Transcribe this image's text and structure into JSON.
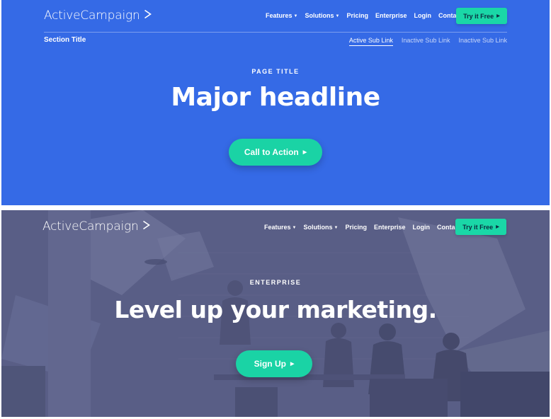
{
  "colors": {
    "blue_bg": "#356ae6",
    "accent_green": "#1ad3a5",
    "photo_overlay": "#5a5f84"
  },
  "icons": {
    "logo_chevron": "chevron-right-icon",
    "dropdown": "caret-down-icon",
    "cta_arrow": "triangle-right-icon"
  },
  "hero_blue": {
    "logo": "ActiveCampaign",
    "nav": {
      "features": "Features",
      "solutions": "Solutions",
      "pricing": "Pricing",
      "enterprise": "Enterprise",
      "login": "Login",
      "contact": "Contact"
    },
    "try_button": "Try it Free",
    "section_title": "Section Title",
    "sublinks": {
      "active": "Active Sub Link",
      "inactive_1": "Inactive Sub Link",
      "inactive_2": "Inactive Sub Link"
    },
    "page_title": "PAGE TITLE",
    "headline": "Major headline",
    "cta": "Call to Action"
  },
  "hero_photo": {
    "logo": "ActiveCampaign",
    "nav": {
      "features": "Features",
      "solutions": "Solutions",
      "pricing": "Pricing",
      "enterprise": "Enterprise",
      "login": "Login",
      "contact": "Contact"
    },
    "try_button": "Try it Free",
    "eyebrow": "ENTERPRISE",
    "headline": "Level up your marketing.",
    "cta": "Sign Up"
  }
}
